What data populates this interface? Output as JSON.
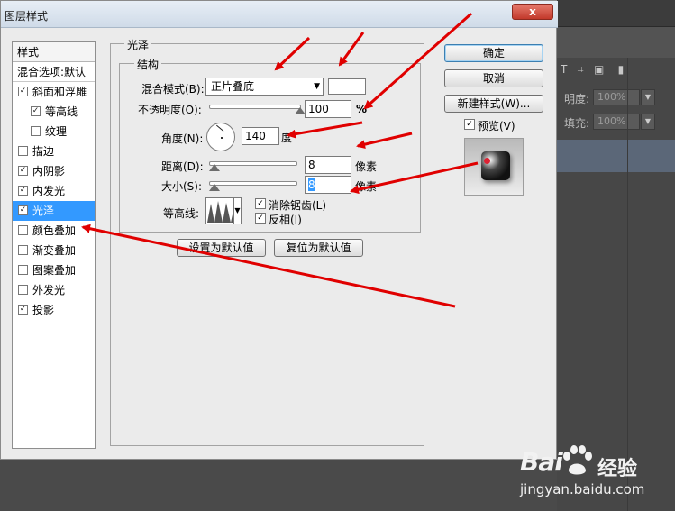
{
  "dialog": {
    "title": "图层样式",
    "close_label": "x"
  },
  "style_list": {
    "header": "样式",
    "blend_default": "混合选项:默认",
    "items": [
      {
        "label": "斜面和浮雕",
        "checked": "✓"
      },
      {
        "label": "等高线",
        "checked": "✓"
      },
      {
        "label": "纹理",
        "checked": ""
      },
      {
        "label": "描边",
        "checked": ""
      },
      {
        "label": "内阴影",
        "checked": "✓"
      },
      {
        "label": "内发光",
        "checked": "✓"
      },
      {
        "label": "光泽",
        "checked": "✓"
      },
      {
        "label": "颜色叠加",
        "checked": ""
      },
      {
        "label": "渐变叠加",
        "checked": ""
      },
      {
        "label": "图案叠加",
        "checked": ""
      },
      {
        "label": "外发光",
        "checked": ""
      },
      {
        "label": "投影",
        "checked": "✓"
      }
    ]
  },
  "satin": {
    "group_title": "光泽",
    "structure_title": "结构",
    "blend_mode_label": "混合模式(B):",
    "blend_mode_value": "正片叠底",
    "opacity_label": "不透明度(O):",
    "opacity_value": "100",
    "opacity_unit": "%",
    "opacity_fraction": 1.0,
    "angle_label": "角度(N):",
    "angle_value": "140",
    "angle_unit": "度",
    "distance_label": "距离(D):",
    "distance_value": "8",
    "distance_unit": "像素",
    "size_label": "大小(S):",
    "size_value": "8",
    "size_unit": "像素",
    "contour_label": "等高线:",
    "anti_alias_label": "消除锯齿(L)",
    "anti_alias_checked": "✓",
    "invert_label": "反相(I)",
    "invert_checked": "✓",
    "set_default_label": "设置为默认值",
    "reset_default_label": "复位为默认值"
  },
  "buttons": {
    "ok": "确定",
    "cancel": "取消",
    "new_style": "新建样式(W)...",
    "preview_label": "预览(V)",
    "preview_checked": "✓"
  },
  "ps_panel": {
    "opacity_label": "明度:",
    "opacity_value": "100%",
    "fill_label": "填充:",
    "fill_value": "100%",
    "top_button": "–"
  },
  "watermark": {
    "brand": "Bai",
    "brand_cn": "经验",
    "url": "jingyan.baidu.com"
  },
  "colors": {
    "selection": "#3399ff",
    "arrow": "#e00000"
  }
}
